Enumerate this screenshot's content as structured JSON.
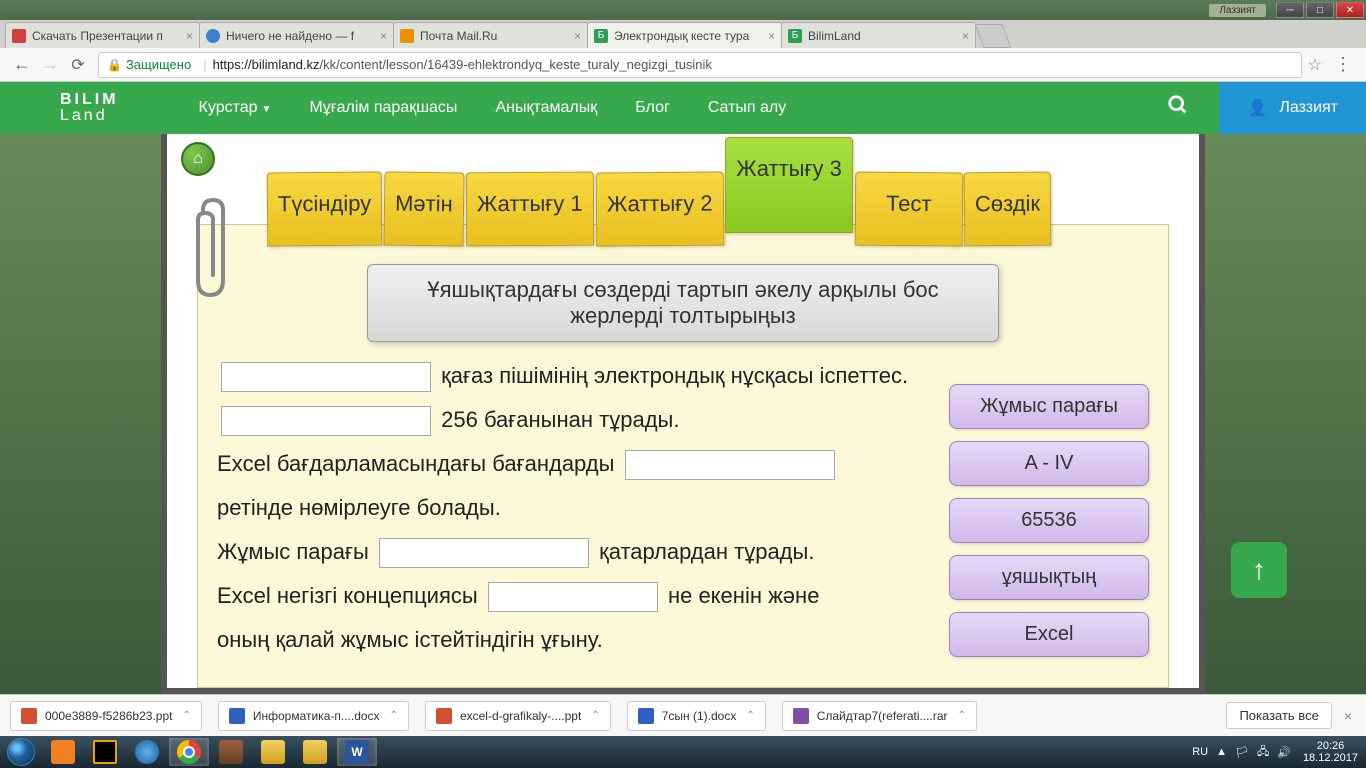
{
  "window": {
    "user": "Лаззият"
  },
  "browser_tabs": [
    {
      "title": "Скачать Презентации п",
      "fav": "#d04040"
    },
    {
      "title": "Ничего не найдено — f",
      "fav": "#4080d0"
    },
    {
      "title": "Почта Mail.Ru",
      "fav": "#f09000"
    },
    {
      "title": "Электрондық кесте тура",
      "fav": "#2aa050"
    },
    {
      "title": "BilimLand",
      "fav": "#2aa050"
    }
  ],
  "url": {
    "secure_label": "Защищено",
    "host": "https://bilimland.kz",
    "path": "/kk/content/lesson/16439-ehlektrondyq_keste_turaly_negizgi_tusinik"
  },
  "nav": {
    "logo_top": "BILIM",
    "logo_bottom": "Land",
    "items": [
      "Курстар",
      "Мұғалім парақшасы",
      "Анықтамалық",
      "Блог",
      "Сатып алу"
    ],
    "user": "Лаззият"
  },
  "lesson": {
    "tabs": [
      "Түсіндіру",
      "Мәтін",
      "Жаттығу 1",
      "Жаттығу 2",
      "Жаттығу 3",
      "Тест",
      "Сөздік"
    ],
    "active_tab": 4,
    "instruction": "Ұяшықтардағы сөздерді тартып әкелу арқылы бос жерлерді толтырыңыз",
    "q1_after": "қағаз пішімінің электрондық нұсқасы іспеттес.",
    "q2_after": "256 бағанынан тұрады.",
    "q3_before": "Excel бағдарламасындағы бағандарды",
    "q3_after": "ретінде нөмірлеуге болады.",
    "q4_before": "Жұмыс парағы",
    "q4_after": "қатарлардан тұрады.",
    "q5_before": "Excel негізгі концепциясы",
    "q5_mid": "не екенін және",
    "q5_after": "оның қалай жұмыс істейтіндігін ұғыну.",
    "drag_items": [
      "Жұмыс парағы",
      "A - IV",
      "65536",
      "ұяшықтың",
      "Excel"
    ]
  },
  "downloads": [
    {
      "name": "000e3889-f5286b23.ppt",
      "color": "#d05030"
    },
    {
      "name": "Информатика-п....docx",
      "color": "#3060c0"
    },
    {
      "name": "excel-d-grafikaly-....ppt",
      "color": "#d05030"
    },
    {
      "name": "7сын (1).docx",
      "color": "#3060c0"
    },
    {
      "name": "Слайдтар7(referati....rar",
      "color": "#8050a0"
    }
  ],
  "downloads_show_all": "Показать все",
  "tray": {
    "lang": "RU",
    "time": "20:26",
    "date": "18.12.2017"
  }
}
